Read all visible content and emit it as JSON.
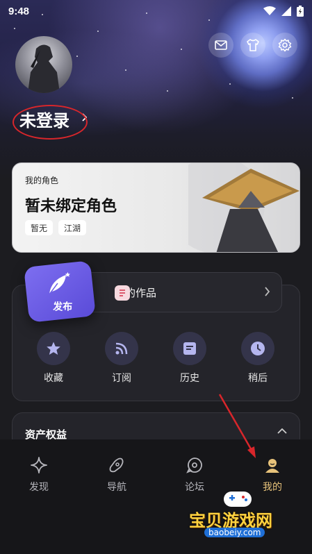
{
  "status": {
    "time": "9:48"
  },
  "header": {
    "login_text": "未登录"
  },
  "role_card": {
    "small_title": "我的角色",
    "title": "暂未绑定角色",
    "tags": [
      "暂无",
      "江湖"
    ]
  },
  "works": {
    "publish_label": "发布",
    "my_works_label": "我的作品"
  },
  "quick_actions": [
    {
      "label": "收藏",
      "icon": "star-icon"
    },
    {
      "label": "订阅",
      "icon": "rss-icon"
    },
    {
      "label": "历史",
      "icon": "history-icon"
    },
    {
      "label": "稍后",
      "icon": "clock-icon"
    }
  ],
  "assets": {
    "title": "资产权益"
  },
  "tabs": [
    {
      "label": "发现",
      "icon": "sparkle-icon"
    },
    {
      "label": "导航",
      "icon": "compass-icon"
    },
    {
      "label": "论坛",
      "icon": "forum-icon"
    },
    {
      "label": "我的",
      "icon": "profile-icon",
      "active": true
    }
  ],
  "watermark": {
    "title": "宝贝游戏网",
    "url": "baobeiy.com"
  },
  "colors": {
    "accent": "#e7c27a",
    "annotation": "#d8262b",
    "publish": "#6b5ce7"
  }
}
